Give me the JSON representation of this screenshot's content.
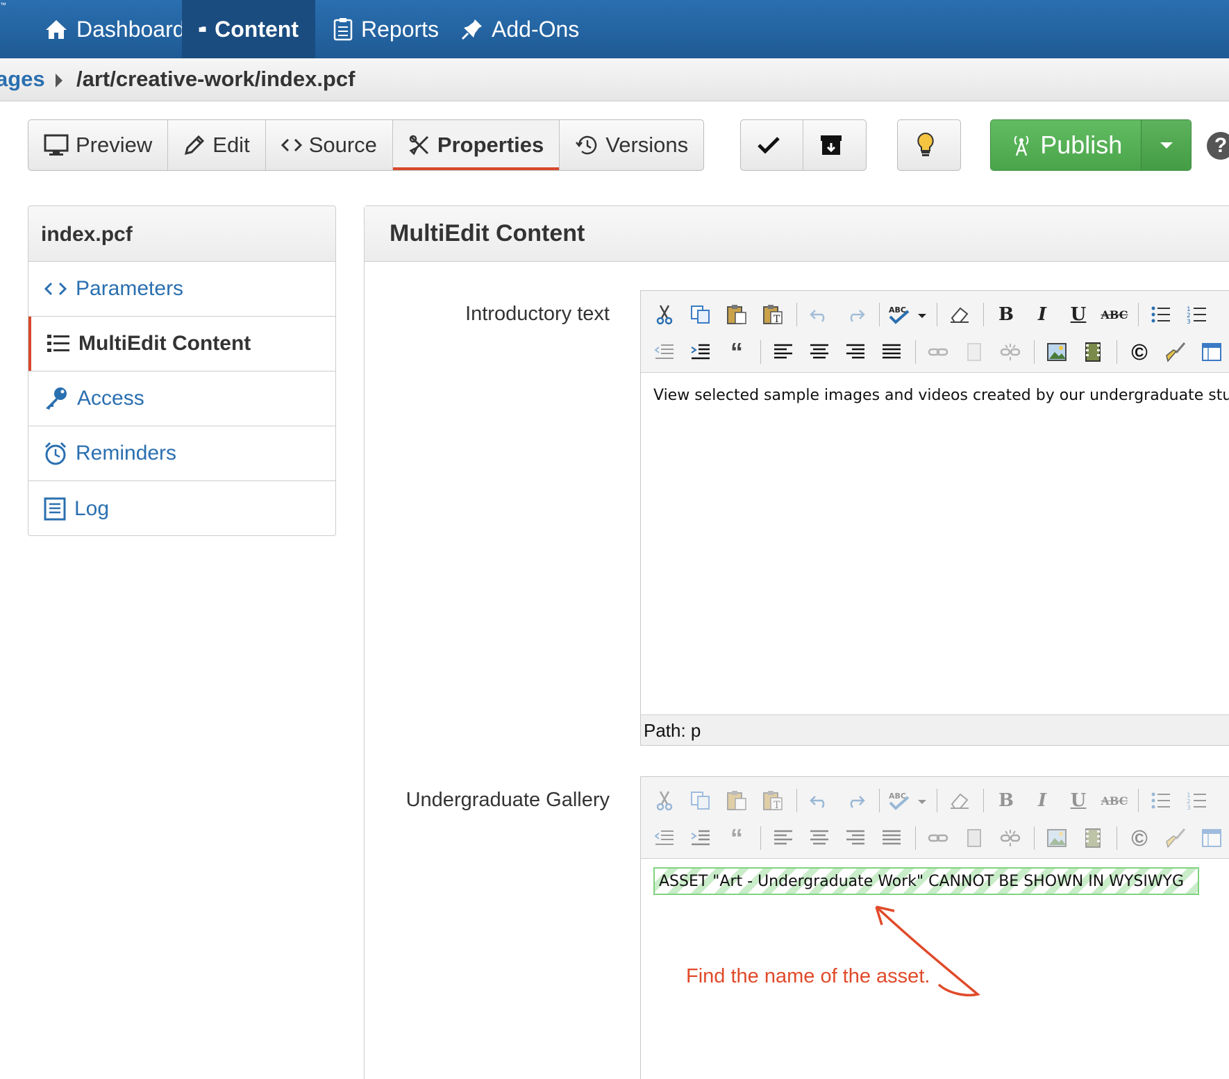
{
  "topnav": {
    "tm": "™",
    "items": [
      {
        "label": "Dashboard",
        "icon": "home-icon"
      },
      {
        "label": "Content",
        "icon": "folder-icon"
      },
      {
        "label": "Reports",
        "icon": "clipboard-icon"
      },
      {
        "label": "Add-Ons",
        "icon": "pushpin-icon"
      }
    ],
    "active": "Content",
    "bg_color": "#2a6fb0"
  },
  "breadcrumb": {
    "link": "ages",
    "path": "/art/creative-work/index.pcf"
  },
  "toolbar": {
    "views": [
      {
        "label": "Preview",
        "icon": "monitor-icon"
      },
      {
        "label": "Edit",
        "icon": "pencil-icon"
      },
      {
        "label": "Source",
        "icon": "code-icon"
      },
      {
        "label": "Properties",
        "icon": "tools-icon"
      },
      {
        "label": "Versions",
        "icon": "history-icon"
      }
    ],
    "active_view": "Properties",
    "publish_label": "Publish",
    "help": "?",
    "accent": "#d9472b",
    "publish_color": "#55ad55"
  },
  "sidebar": {
    "title": "index.pcf",
    "items": [
      {
        "label": "Parameters",
        "icon": "code-icon"
      },
      {
        "label": "MultiEdit Content",
        "icon": "list-icon"
      },
      {
        "label": "Access",
        "icon": "key-icon"
      },
      {
        "label": "Reminders",
        "icon": "alarm-clock-icon"
      },
      {
        "label": "Log",
        "icon": "log-icon"
      }
    ],
    "active": "MultiEdit Content"
  },
  "main": {
    "title": "MultiEdit Content",
    "fields": [
      {
        "label": "Introductory text",
        "content": "View selected sample images and videos created by our undergraduate stu",
        "path": "Path: p"
      },
      {
        "label": "Undergraduate Gallery",
        "asset_text": "ASSET \"Art - Undergraduate Work\" CANNOT BE SHOWN IN WYSIWYG"
      }
    ],
    "annotation": "Find the name of the asset.",
    "annotation_color": "#e04a2a"
  },
  "editor_toolbar": {
    "bold": "B",
    "italic": "I",
    "underline": "U",
    "strike": "ABC",
    "quote": "“",
    "copyright": "©",
    "spell": "ABC"
  }
}
